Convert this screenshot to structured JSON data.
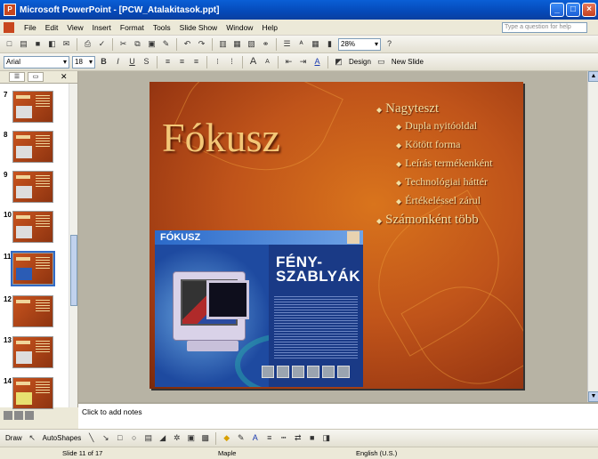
{
  "window": {
    "title": "Microsoft PowerPoint - [PCW_Atalakitasok.ppt]",
    "buttons": [
      "_",
      "□",
      "×"
    ]
  },
  "menu": {
    "items": [
      "File",
      "Edit",
      "View",
      "Insert",
      "Format",
      "Tools",
      "Slide Show",
      "Window",
      "Help"
    ],
    "help_placeholder": "Type a question for help"
  },
  "toolbar": {
    "zoom": "28%",
    "font": "Arial",
    "font_size": "18",
    "design_label": "Design",
    "new_slide_label": "New Slide"
  },
  "slides_panel": {
    "thumbnails": [
      {
        "num": "7",
        "selected": false
      },
      {
        "num": "8",
        "selected": false
      },
      {
        "num": "9",
        "selected": false
      },
      {
        "num": "10",
        "selected": false
      },
      {
        "num": "11",
        "selected": true
      },
      {
        "num": "12",
        "selected": false
      },
      {
        "num": "13",
        "selected": false
      },
      {
        "num": "14",
        "selected": false
      }
    ]
  },
  "slide": {
    "title": "Fókusz",
    "bullets": [
      {
        "level": 1,
        "text": "Nagyteszt"
      },
      {
        "level": 2,
        "text": "Dupla nyitóoldal"
      },
      {
        "level": 2,
        "text": "Kötött forma"
      },
      {
        "level": 2,
        "text": "Leírás termékenként"
      },
      {
        "level": 2,
        "text": "Technológiai háttér"
      },
      {
        "level": 2,
        "text": "Értékeléssel zárul"
      },
      {
        "level": 1,
        "text": "Számonként több"
      }
    ],
    "magazine": {
      "logo": "FÓKUSZ",
      "headline_line1": "FÉNY-",
      "headline_line2": "SZABLYÁK"
    }
  },
  "notes": {
    "placeholder": "Click to add notes"
  },
  "drawing": {
    "draw_label": "Draw",
    "autoshapes_label": "AutoShapes"
  },
  "status": {
    "slide": "Slide 11 of 17",
    "design": "Maple",
    "language": "English (U.S.)"
  }
}
